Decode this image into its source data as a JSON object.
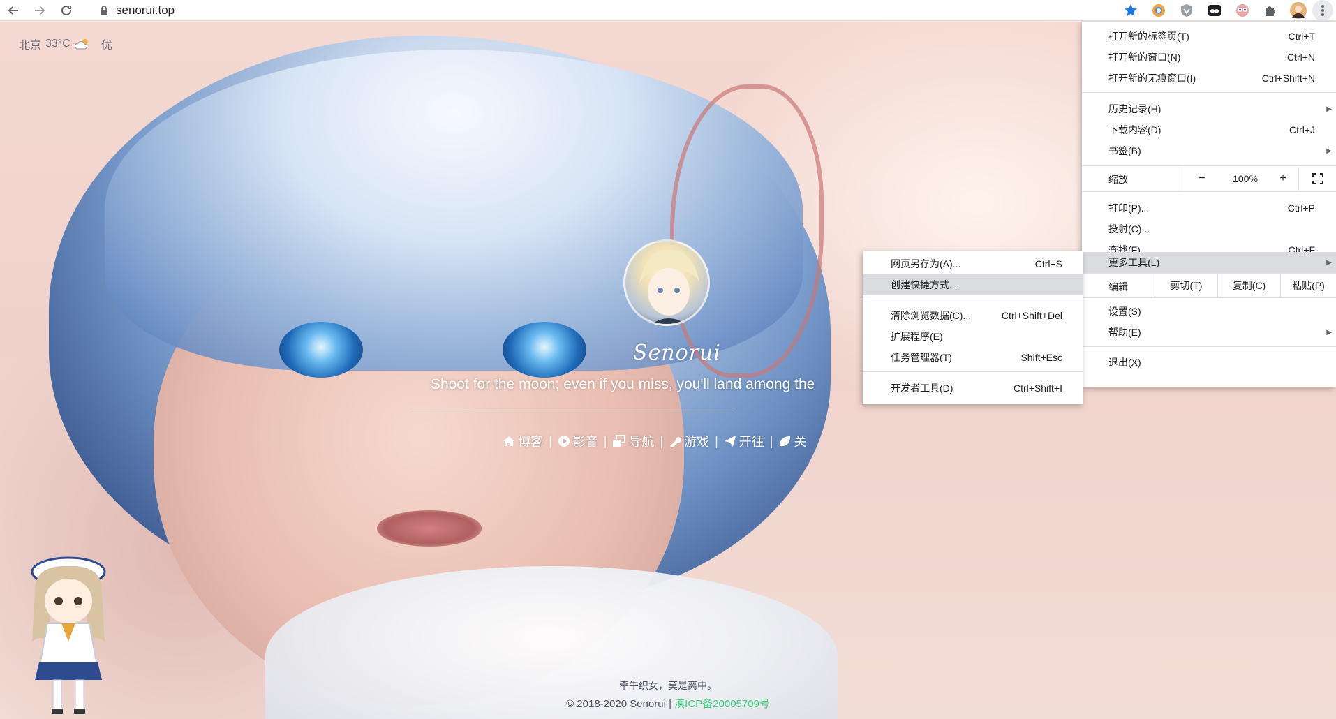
{
  "browser": {
    "url": "senorui.top",
    "nav": {
      "back_icon": "arrow-left-icon",
      "forward_icon": "arrow-right-icon",
      "reload_icon": "reload-icon"
    },
    "extensions": [
      "bookmark-star-icon",
      "chrome-extension-icon",
      "shield-extension-icon",
      "media-extension-icon",
      "eyes-extension-icon",
      "puzzle-extensions-icon",
      "profile-avatar",
      "more-menu-icon"
    ]
  },
  "page": {
    "weather": {
      "city": "北京",
      "temp": "33°C",
      "condition_icon": "cloud-sun-icon",
      "aqi": "优"
    },
    "site_title": "Senorui",
    "motto": "Shoot for the moon; even if you miss, you'll land among the",
    "links": [
      {
        "icon": "home-icon",
        "label": "博客"
      },
      {
        "icon": "play-circle-icon",
        "label": "影音"
      },
      {
        "icon": "window-icon",
        "label": "导航"
      },
      {
        "icon": "wrench-icon",
        "label": "游戏"
      },
      {
        "icon": "paper-plane-icon",
        "label": "开往"
      },
      {
        "icon": "leaf-icon",
        "label": "关"
      }
    ],
    "footer_line1": "牵牛织女，莫是离中。",
    "footer_copyright": "© 2018-2020 Senorui",
    "footer_sep": "|",
    "footer_icp": "滇ICP备20005709号"
  },
  "chrome_menu": {
    "items_group1": [
      {
        "label": "打开新的标签页(T)",
        "shortcut": "Ctrl+T"
      },
      {
        "label": "打开新的窗口(N)",
        "shortcut": "Ctrl+N"
      },
      {
        "label": "打开新的无痕窗口(I)",
        "shortcut": "Ctrl+Shift+N"
      }
    ],
    "items_group2": [
      {
        "label": "历史记录(H)",
        "shortcut": "",
        "arrow": "▶"
      },
      {
        "label": "下载内容(D)",
        "shortcut": "Ctrl+J"
      },
      {
        "label": "书签(B)",
        "shortcut": "",
        "arrow": "▶"
      }
    ],
    "zoom": {
      "label": "缩放",
      "minus": "−",
      "value": "100%",
      "plus": "+",
      "fullscreen_icon": "fullscreen-icon"
    },
    "items_group3": [
      {
        "label": "打印(P)...",
        "shortcut": "Ctrl+P"
      },
      {
        "label": "投射(C)...",
        "shortcut": ""
      },
      {
        "label": "查找(F)...",
        "shortcut": "Ctrl+F"
      },
      {
        "label": "更多工具(L)",
        "shortcut": "",
        "arrow": "▶"
      }
    ],
    "edit": {
      "label": "编辑",
      "cut": "剪切(T)",
      "copy": "复制(C)",
      "paste": "粘贴(P)"
    },
    "items_group4": [
      {
        "label": "设置(S)",
        "shortcut": ""
      },
      {
        "label": "帮助(E)",
        "shortcut": "",
        "arrow": "▶"
      }
    ],
    "exit": {
      "label": "退出(X)"
    }
  },
  "more_tools_menu": {
    "group1": [
      {
        "label": "网页另存为(A)...",
        "shortcut": "Ctrl+S"
      },
      {
        "label": "创建快捷方式...",
        "shortcut": ""
      }
    ],
    "group2": [
      {
        "label": "清除浏览数据(C)...",
        "shortcut": "Ctrl+Shift+Del"
      },
      {
        "label": "扩展程序(E)",
        "shortcut": ""
      },
      {
        "label": "任务管理器(T)",
        "shortcut": "Shift+Esc"
      }
    ],
    "group3": [
      {
        "label": "开发者工具(D)",
        "shortcut": "Ctrl+Shift+I"
      }
    ]
  }
}
